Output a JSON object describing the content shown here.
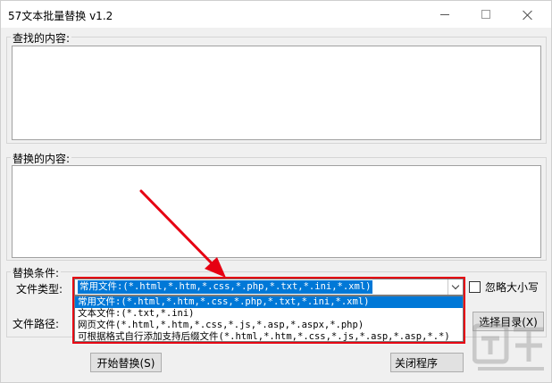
{
  "window": {
    "title": "57文本批量替换 v1.2",
    "minimize_icon": "minimize-icon",
    "maximize_icon": "maximize-icon",
    "close_icon": "close-icon"
  },
  "find_group": {
    "label": "查找的内容:"
  },
  "replace_group": {
    "label": "替换的内容:"
  },
  "conditions": {
    "label": "替换条件:",
    "file_type_label": "文件类型:",
    "file_path_label": "文件路径:",
    "file_type_selected": "常用文件:(*.html,*.htm,*.css,*.php,*.txt,*.ini,*.xml)",
    "file_type_options": [
      "常用文件:(*.html,*.htm,*.css,*.php,*.txt,*.ini,*.xml)",
      "文本文件:(*.txt,*.ini)",
      "网页文件(*.html,*.htm,*.css,*.js,*.asp,*.aspx,*.php)",
      "可根据格式自行添加支持后缀文件(*.html,*.htm,*.css,*.js,*.asp,*.asp,*.*)"
    ],
    "ignore_case_label": "忽略大小写",
    "select_dir_button": "选择目录(X)"
  },
  "actions": {
    "start_button": "开始替换(S)",
    "close_button": "关闭程序"
  },
  "colors": {
    "highlight": "#0078d7",
    "annotation_red": "#e60012"
  }
}
